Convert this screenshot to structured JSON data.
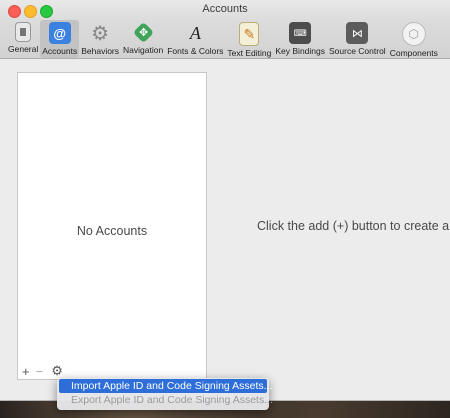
{
  "window": {
    "title": "Accounts"
  },
  "toolbar": {
    "items": [
      {
        "label": "General",
        "icon": "general-icon"
      },
      {
        "label": "Accounts",
        "icon": "at-sign-icon"
      },
      {
        "label": "Behaviors",
        "icon": "gear-icon"
      },
      {
        "label": "Navigation",
        "icon": "navigation-arrows-icon"
      },
      {
        "label": "Fonts & Colors",
        "icon": "fonts-colors-icon"
      },
      {
        "label": "Text Editing",
        "icon": "text-editing-icon"
      },
      {
        "label": "Key Bindings",
        "icon": "keyboard-icon"
      },
      {
        "label": "Source Control",
        "icon": "source-control-icon"
      },
      {
        "label": "Components",
        "icon": "components-icon"
      }
    ],
    "selected": "Accounts"
  },
  "accounts": {
    "empty_text": "No Accounts",
    "add_label": "+",
    "remove_label": "−",
    "gear_label": "⚙"
  },
  "detail": {
    "message": "Click the add (+) button to create a n"
  },
  "menu": {
    "items": [
      {
        "label": "Import Apple ID and Code Signing Assets...",
        "state": "highlighted"
      },
      {
        "label": "Export Apple ID and Code Signing Assets...",
        "state": "disabled"
      }
    ]
  },
  "colors": {
    "accent": "#2e6ed9",
    "accounts_icon": "#3b82e0"
  }
}
